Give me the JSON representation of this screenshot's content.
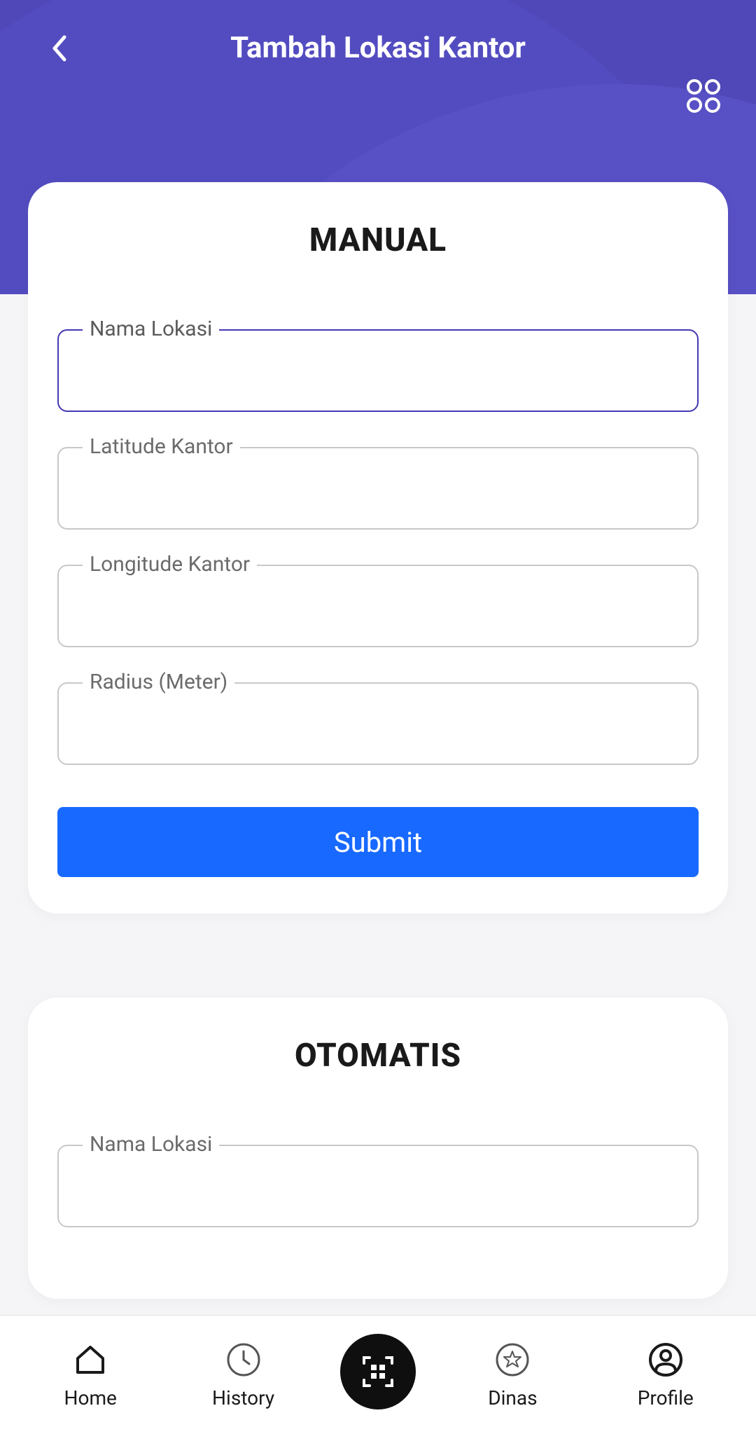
{
  "header": {
    "title": "Tambah Lokasi Kantor"
  },
  "manual": {
    "title": "MANUAL",
    "fields": {
      "nama_lokasi": {
        "label": "Nama Lokasi",
        "value": ""
      },
      "latitude": {
        "label": "Latitude Kantor",
        "value": ""
      },
      "longitude": {
        "label": "Longitude Kantor",
        "value": ""
      },
      "radius": {
        "label": "Radius (Meter)",
        "value": ""
      }
    },
    "submit_label": "Submit"
  },
  "otomatis": {
    "title": "OTOMATIS",
    "fields": {
      "nama_lokasi": {
        "label": "Nama Lokasi",
        "value": ""
      }
    }
  },
  "nav": {
    "home": "Home",
    "history": "History",
    "dinas": "Dinas",
    "profile": "Profile"
  }
}
